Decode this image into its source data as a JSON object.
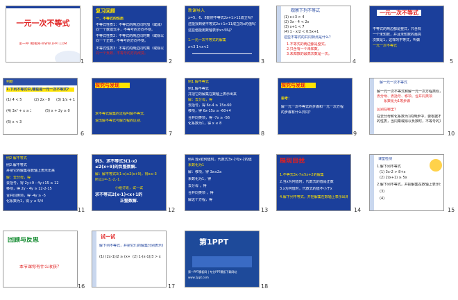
{
  "slides": [
    {
      "num": "1",
      "title": "一元一次不等式",
      "site": "第一PPT模板网-WWW.1PPT.COM"
    },
    {
      "num": "2",
      "heading": "复习回顾",
      "lines": [
        "一、不等式的性质",
        "不等式性质1：不等式的两边同时加（或减）",
        "同一个数或式子，不等号的方向不变。",
        "不等式性质2：不等式的两边同时乘（或除以）",
        "同一个正数，不等号的方向不变。",
        "不等式性质3：不等式的两边同时乘（或除以）",
        "同一个负数，不等号的方向改变。"
      ]
    },
    {
      "num": "3",
      "heading": "新课导入",
      "lines": [
        "x=5、6、8能使不等式2x+1>11成立吗？",
        "还能找到使不等式2x+1>11成立的x的值吗？",
        "这些值能用数轴表示x>5吗？",
        "1.一元一次不等式的解集",
        "x<3  1<x<2"
      ]
    },
    {
      "num": "4",
      "heading": "观察下列不等式",
      "lines": [
        "(1) x+3 > 4",
        "(2) 3x - 4 < 2x",
        "(3) x+1 < 7",
        "(4) 1 - x/2 < 0.5x+1",
        "这些不等式的共同特点是什么？",
        "1.不等式的两边都是整式。",
        "2.只含有一个未知数。",
        "3.未知数的最高次数是一次。"
      ]
    },
    {
      "num": "5",
      "heading": "一元一次不等式",
      "lines": [
        "不等式的两边都是整式，只含有",
        "一个未知数，并且未知数的最高",
        "次数是1，这样的不等式，叫做",
        "一元一次不等式"
      ]
    },
    {
      "num": "6",
      "heading": "判断",
      "lines": [
        "1.下列不等式中,哪些是一元一次不等式?",
        "(1) 4 < 5",
        "(2) 2x - 8",
        "(3) 1/x + 1 < 3",
        "(4) 3x² + x ≥ 2",
        "(5) x + 2y ≥ 0",
        "(6) x < 3"
      ]
    },
    {
      "num": "7",
      "heading": "探究与发现",
      "lines": [
        "求不等式解集的过程叫解不等式.",
        "说出解不等式与解方程的区别."
      ]
    },
    {
      "num": "8",
      "heading": "例1 解不等式",
      "lines": [
        "例1.解不等式",
        "并把它的解集在数轴上表示出来",
        "解：去分母，得",
        "去括号，得 6x-4 ≥ 15x-60",
        "移项，得 6x-15x ≥ -60+4",
        "合并同类项，得 -7x ≥ -56",
        "化系数为1，得 x ≤ 8"
      ]
    },
    {
      "num": "9",
      "heading": "探究与发现",
      "lines": [
        "思考：",
        "解一元一次不等式的步骤和一元一次方程",
        "的步骤有什么异同？"
      ]
    },
    {
      "num": "10",
      "heading": "解一元一次不等式",
      "lines": [
        "解一元一次不等式和解一元一次方程类似，有",
        "去分母、去括号、移项、合并同类项",
        "系数化为1等步骤",
        "区别在哪里？",
        "在去分母和化系数为1的两步中，要根据不等式",
        "的性质，当同乘或除以负数时，不等号的方向改变"
      ]
    },
    {
      "num": "11",
      "heading": "例2 解不等式",
      "lines": [
        "例2.解不等式",
        "并把它的解集在数轴上表示出来",
        "解：去分母，得",
        "去括号，得 2y+9 - 4y+15 ≥ 12",
        "移项，得 2y - 4y ≥ 12-2-15",
        "合并同类项，得 -4y ≥ -5",
        "化系数为1，得 y ≤ 5/4"
      ]
    },
    {
      "num": "12",
      "heading": "例3",
      "lines": [
        "例3、求不等式3(1-x)",
        "≤2(x+9)的负整数解.",
        "解：解不等式3(1-x)≤2(x+9)，得x≥-3",
        "所以x=-3,-2,-1.",
        "小组讨论，试一试",
        "求不等式2(x-1)<x+1的",
        "正整数解."
      ]
    },
    {
      "num": "13",
      "heading": "例4",
      "lines": [
        "例4.当x取何值时，代数式3x-2与x-2的值",
        "系数化为1",
        "解：移项，得 3x≤2a",
        "系数化为1，得",
        "去分母 ，得",
        "合并同类项 ，得",
        "解这个方程，得"
      ]
    },
    {
      "num": "14",
      "heading": "展现自我",
      "lines": [
        "1.不等式3x-7≤5x+2的解集",
        "2.当x为何值时，代数式的值是正数",
        "3.x为何值时，代数式的值不小于x",
        "4.解下列不等式，并把解集在数轴上表示出来"
      ]
    },
    {
      "num": "15",
      "heading": "课堂检测",
      "lines": [
        "1.解下列不等式",
        "(1) 3x-2 > 8+x",
        "(2) 2(x+1) ≥ 5x",
        "2.解下列不等式，并把解集在数轴上表示出来",
        "(3)",
        "(4)"
      ]
    },
    {
      "num": "16",
      "heading": "回顾与反思",
      "lines": [
        "本节课你有什么收获？"
      ]
    },
    {
      "num": "17",
      "heading": "试一试",
      "lines": [
        "解下列不等式，并把它们的解集分别表示在数轴上.",
        "(1) (2x-1)/2 ≥ (x+4)/3",
        "(2) 1-(x-1)/3 > x"
      ]
    },
    {
      "num": "18",
      "heading": "第1PPT",
      "lines": [
        "第一PPT模板网 | 专业PPT模板下载网站",
        "www.1ppt.com"
      ]
    }
  ],
  "colors": {
    "slide_blue": "#1b3f9b",
    "accent_yellow": "#ffe400",
    "accent_red": "#e02020",
    "green_title": "#2d8a3a"
  }
}
